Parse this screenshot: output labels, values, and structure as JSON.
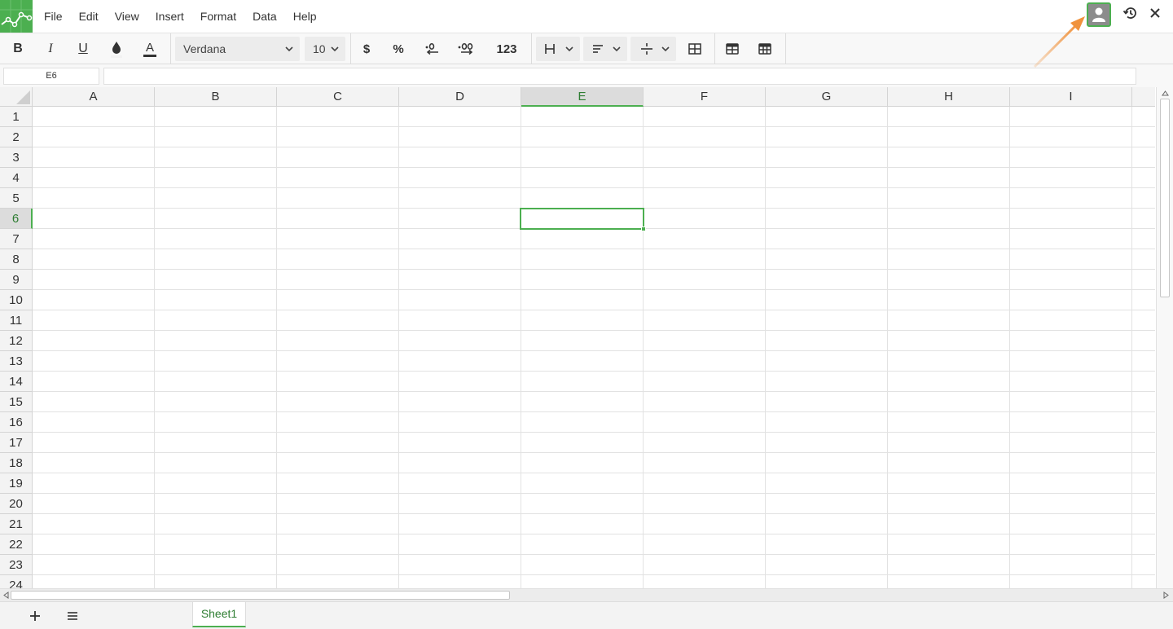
{
  "app": {
    "menu": [
      "File",
      "Edit",
      "View",
      "Insert",
      "Format",
      "Data",
      "Help"
    ]
  },
  "toolbar": {
    "bold_label": "B",
    "italic_label": "I",
    "underline_label": "U",
    "font_name": "Verdana",
    "font_size": "10",
    "currency_label": "$",
    "percent_label": "%",
    "number_format_label": "123"
  },
  "formula_bar": {
    "cell_ref": "E6",
    "formula": ""
  },
  "grid": {
    "columns": [
      "A",
      "B",
      "C",
      "D",
      "E",
      "F",
      "G",
      "H",
      "I"
    ],
    "rows": [
      "1",
      "2",
      "3",
      "4",
      "5",
      "6",
      "7",
      "8",
      "9",
      "10",
      "11",
      "12",
      "13",
      "14",
      "15",
      "16",
      "17",
      "18",
      "19",
      "20",
      "21",
      "22",
      "23",
      "24"
    ],
    "selected_column": "E",
    "selected_row": "6"
  },
  "sheets": {
    "tabs": [
      "Sheet1"
    ],
    "active": "Sheet1"
  },
  "colors": {
    "accent": "#4caf50",
    "annotation_arrow": "#f0923c"
  },
  "icons": {
    "logo": "app-logo-icon",
    "avatar": "user-avatar-icon",
    "history": "history-icon",
    "close": "close-icon"
  }
}
